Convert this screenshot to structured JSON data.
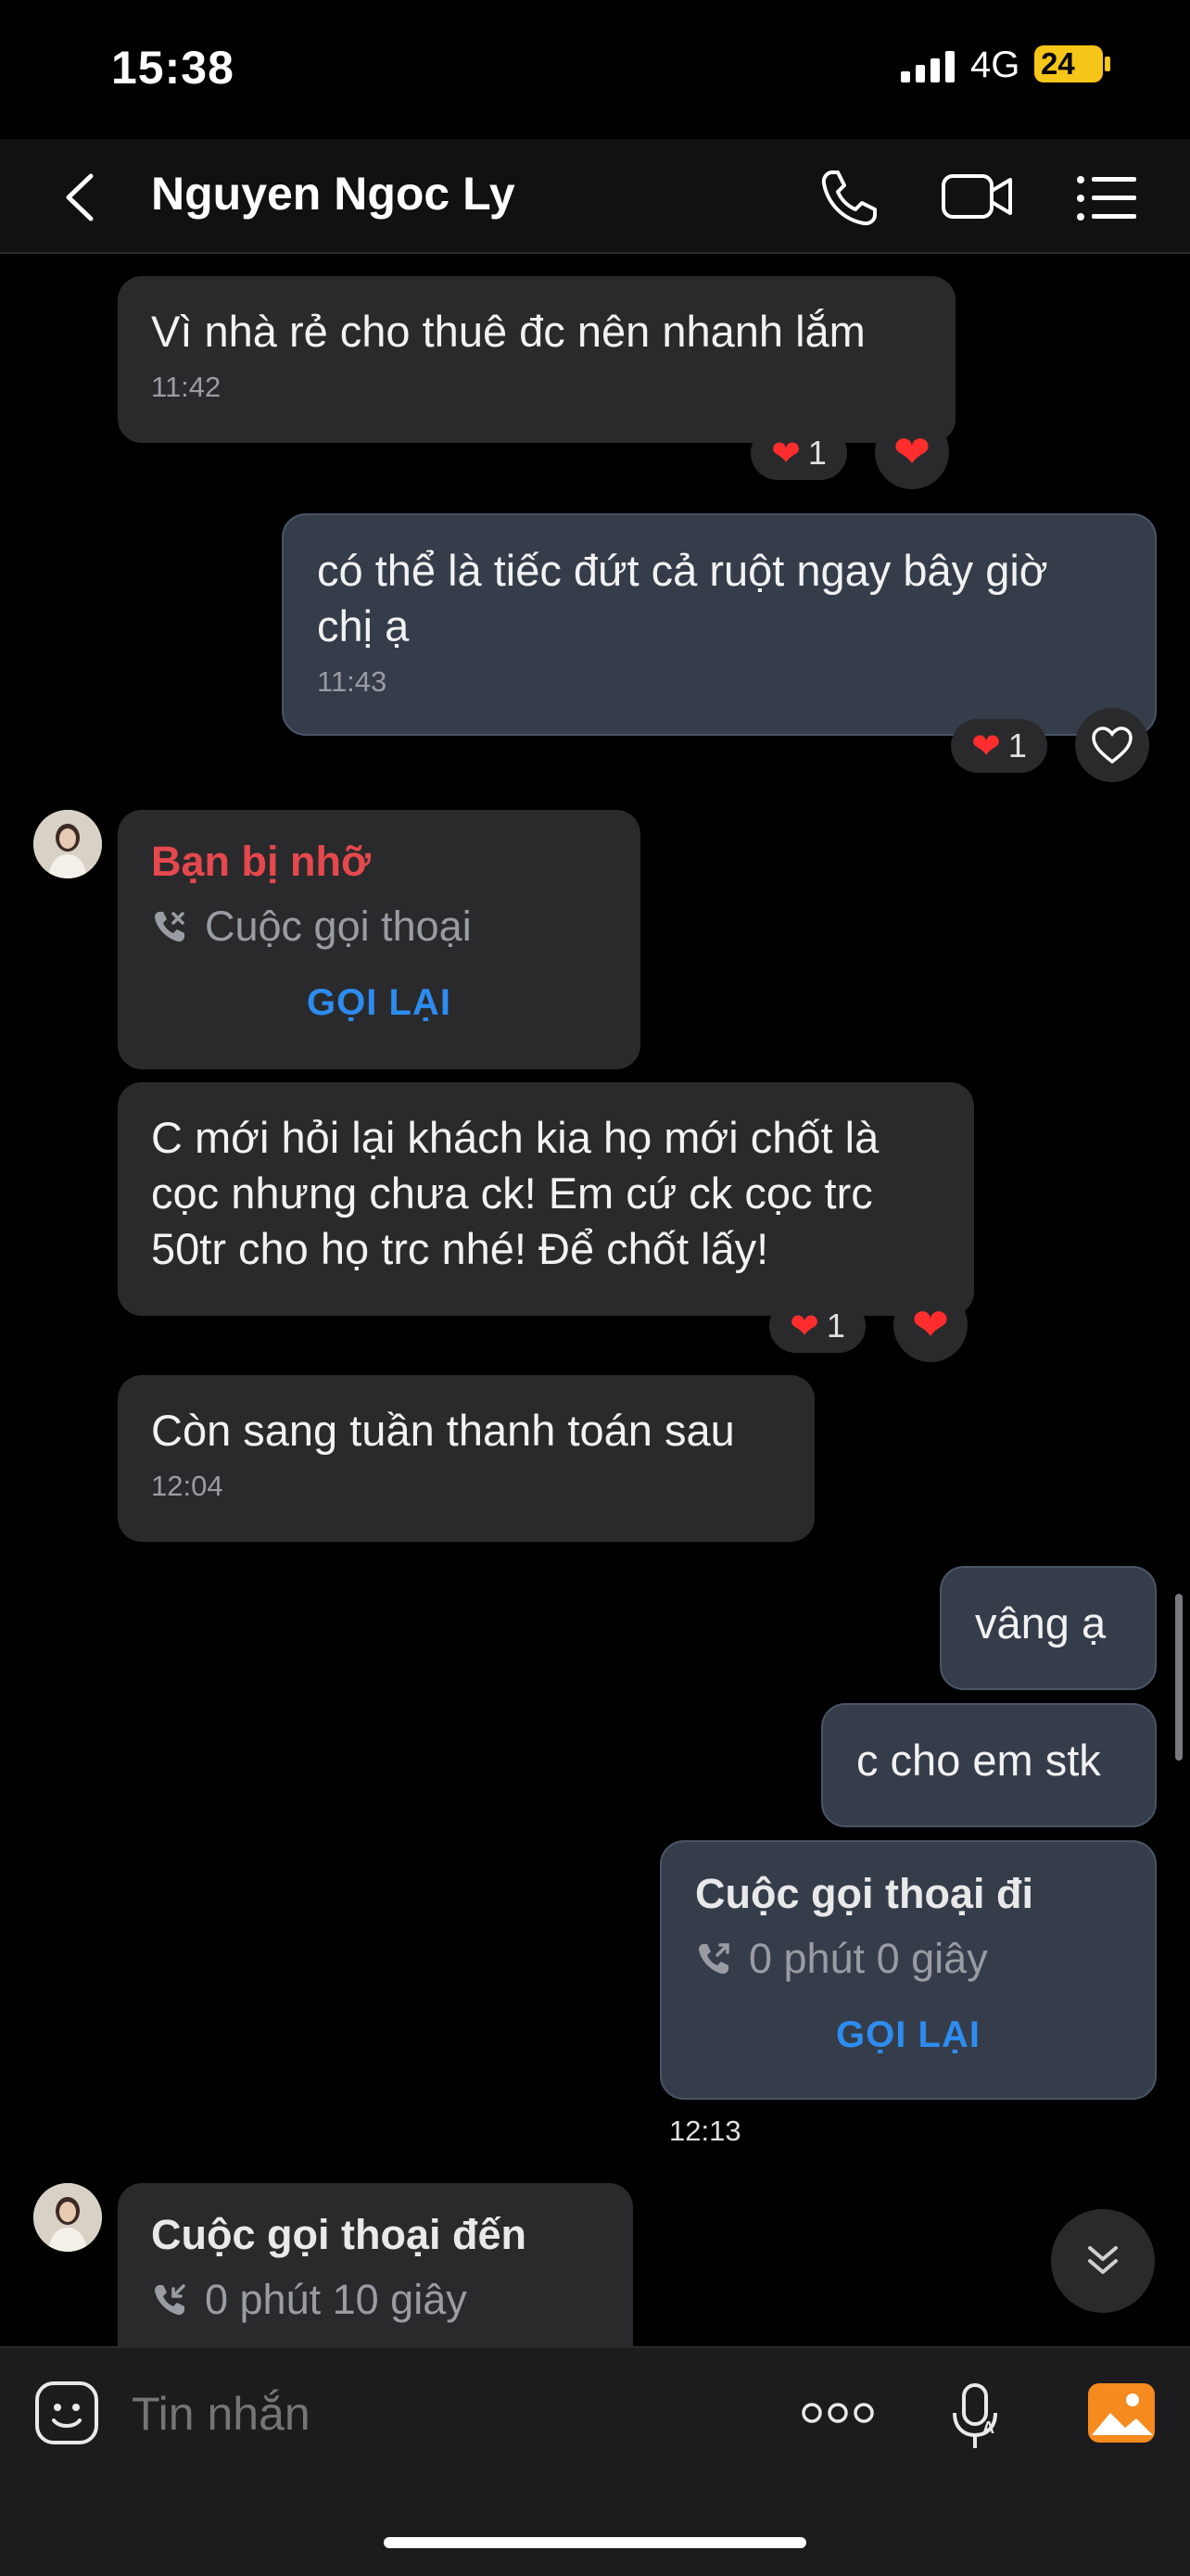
{
  "status_bar": {
    "time": "15:38",
    "network": "4G",
    "battery": "24"
  },
  "header": {
    "contact_name": "Nguyen Ngoc Ly"
  },
  "messages": {
    "m1": {
      "text": "Vì nhà rẻ cho thuê đc nên nhanh lắm",
      "time": "11:42",
      "reaction_count": "1"
    },
    "m2": {
      "text": "có thể là tiếc đứt cả ruột ngay bây giờ\nchị ạ",
      "time": "11:43",
      "reaction_count": "1"
    },
    "m3": {
      "title": "Bạn bị nhỡ",
      "subtitle": "Cuộc gọi thoại",
      "action": "GỌI LẠI"
    },
    "m4": {
      "text": "C mới hỏi lại khách kia họ mới chốt là\ncọc nhưng chưa ck! Em cứ ck cọc trc\n50tr cho họ trc nhé! Để chốt lấy!",
      "reaction_count": "1"
    },
    "m5": {
      "text": "Còn sang tuần thanh toán sau",
      "time": "12:04"
    },
    "m6": {
      "text": "vâng ạ"
    },
    "m7": {
      "text": "c cho em stk"
    },
    "m8": {
      "title": "Cuộc gọi thoại đi",
      "subtitle": "0 phút 0 giây",
      "action": "GỌI LẠI",
      "time": "12:13"
    },
    "m9": {
      "title": "Cuộc gọi thoại đến",
      "subtitle": "0 phút 10 giây"
    }
  },
  "composer": {
    "placeholder": "Tin nhắn"
  },
  "colors": {
    "accent": "#2d8cf0",
    "missed": "#e5484d",
    "heart": "#ff2d2d"
  }
}
